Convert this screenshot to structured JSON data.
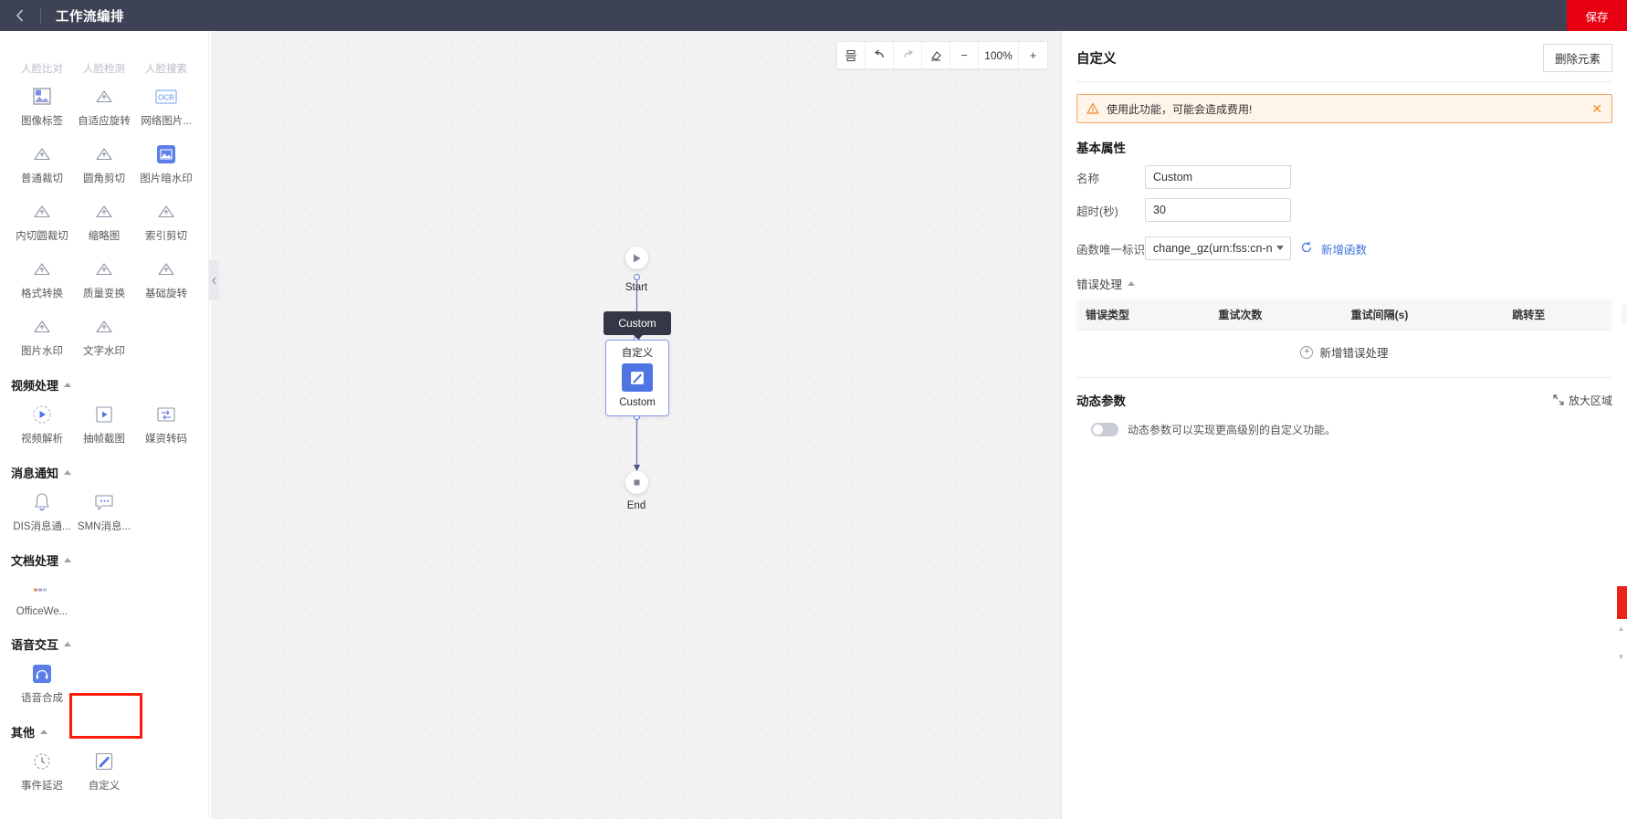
{
  "topbar": {
    "back_icon": "chevron-left-icon",
    "title": "工作流编排",
    "save_label": "保存",
    "save_color": "#e60012"
  },
  "palette": {
    "partial_row": [
      {
        "label": "人脸比对",
        "icon": "cloud-icon"
      },
      {
        "label": "人脸检测",
        "icon": "cloud-icon"
      },
      {
        "label": "人脸搜索",
        "icon": "cloud-icon"
      }
    ],
    "image_items": [
      {
        "label": "图像标签",
        "icon": "image-tag-icon"
      },
      {
        "label": "自适应旋转",
        "icon": "cloud-icon"
      },
      {
        "label": "网络图片...",
        "icon": "ocr-icon"
      },
      {
        "label": "普通裁切",
        "icon": "cloud-icon"
      },
      {
        "label": "圆角剪切",
        "icon": "cloud-icon"
      },
      {
        "label": "图片暗水印",
        "icon": "watermark-icon"
      },
      {
        "label": "内切圆裁切",
        "icon": "cloud-icon"
      },
      {
        "label": "缩略图",
        "icon": "cloud-icon"
      },
      {
        "label": "索引剪切",
        "icon": "cloud-icon"
      },
      {
        "label": "格式转换",
        "icon": "cloud-icon"
      },
      {
        "label": "质量变换",
        "icon": "cloud-icon"
      },
      {
        "label": "基础旋转",
        "icon": "cloud-icon"
      },
      {
        "label": "图片水印",
        "icon": "cloud-icon"
      },
      {
        "label": "文字水印",
        "icon": "cloud-icon"
      }
    ],
    "sections": [
      {
        "title": "视频处理",
        "items": [
          {
            "label": "视频解析",
            "icon": "video-play-icon"
          },
          {
            "label": "抽帧截图",
            "icon": "frame-capture-icon"
          },
          {
            "label": "媒资转码",
            "icon": "transcode-icon"
          }
        ]
      },
      {
        "title": "消息通知",
        "items": [
          {
            "label": "DIS消息通...",
            "icon": "bell-icon"
          },
          {
            "label": "SMN消息...",
            "icon": "chat-icon"
          }
        ]
      },
      {
        "title": "文档处理",
        "items": [
          {
            "label": "OfficeWe...",
            "icon": "office-icon"
          }
        ]
      },
      {
        "title": "语音交互",
        "items": [
          {
            "label": "语音合成",
            "icon": "headset-icon"
          }
        ]
      },
      {
        "title": "其他",
        "items": [
          {
            "label": "事件延迟",
            "icon": "clock-icon"
          },
          {
            "label": "自定义",
            "icon": "pencil-square-icon",
            "highlighted": true
          }
        ]
      }
    ],
    "highlight_color": "#fb1b0b"
  },
  "canvas": {
    "toolbar": {
      "align_icon": "align-icon",
      "undo_icon": "undo-arrow-icon",
      "redo_icon": "redo-arrow-icon",
      "erase_icon": "eraser-icon",
      "zoom_out_label": "−",
      "zoom_level": "100%",
      "zoom_in_label": "+"
    },
    "nodes": {
      "start_label": "Start",
      "start_icon": "play-triangle-icon",
      "end_label": "End",
      "end_icon": "stop-square-icon",
      "tooltip_label": "Custom",
      "custom_title": "自定义",
      "custom_name": "Custom",
      "custom_icon": "pencil-square-icon",
      "accent_color": "#4f74e3"
    }
  },
  "properties": {
    "title": "自定义",
    "delete_label": "删除元素",
    "alert": {
      "icon": "warning-triangle-icon",
      "text": "使用此功能，可能会造成费用!",
      "close_icon": "close-icon",
      "color": "#f0892c"
    },
    "basic_section_title": "基本属性",
    "fields": {
      "name_label": "名称",
      "name_value": "Custom",
      "timeout_label": "超时(秒)",
      "timeout_value": "30",
      "function_label": "函数唯一标识",
      "function_value": "change_gz(urn:fss:cn-nort...",
      "refresh_icon": "refresh-icon",
      "new_function_link": "新增函数"
    },
    "error_section": {
      "title": "错误处理",
      "columns": [
        "错误类型",
        "重试次数",
        "重试间隔(s)",
        "跳转至"
      ],
      "rows": [],
      "add_label": "新增错误处理",
      "add_icon": "plus-circle-icon"
    },
    "dynamic_section": {
      "title": "动态参数",
      "zoom_area_label": "放大区域",
      "zoom_area_icon": "expand-icon",
      "toggle_on": false,
      "toggle_text": "动态参数可以实现更高级别的自定义功能。"
    }
  }
}
